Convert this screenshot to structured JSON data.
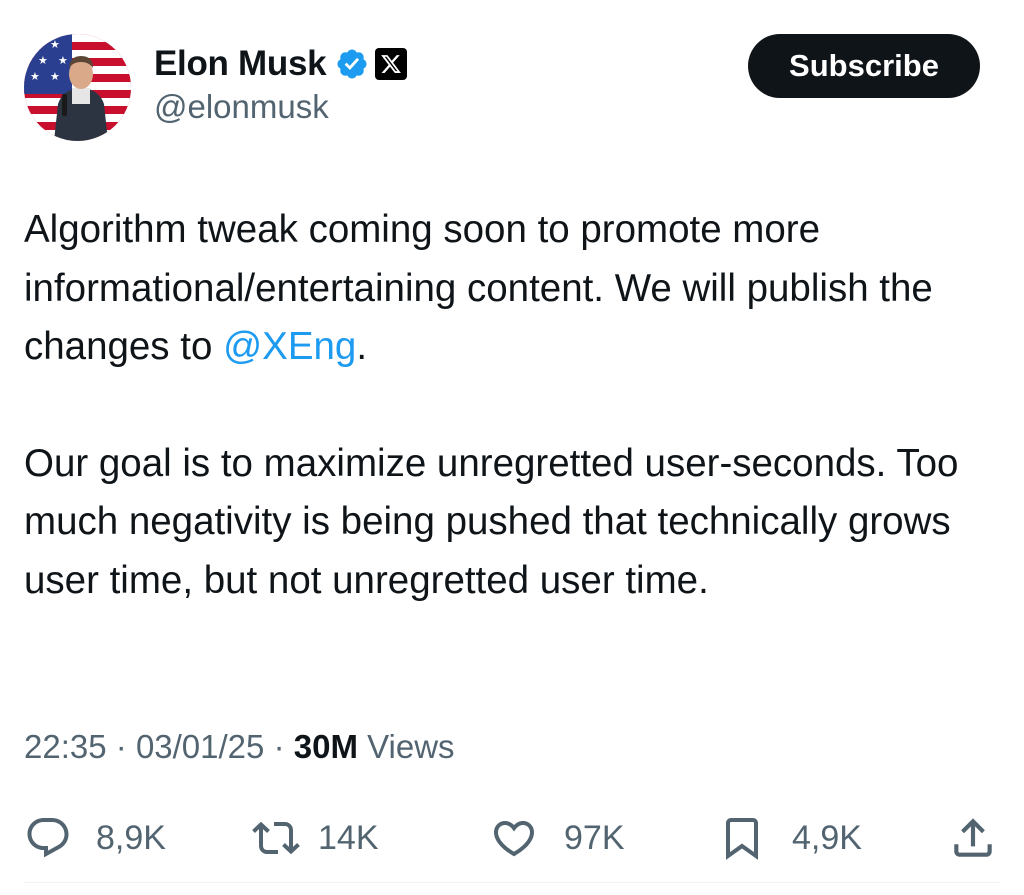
{
  "author": {
    "name": "Elon Musk",
    "handle": "@elonmusk",
    "verified_color": "#1d9bf0"
  },
  "header": {
    "subscribe_label": "Subscribe"
  },
  "tweet": {
    "p1_before": "Algorithm tweak coming soon to promote more informational/entertaining content. We will publish the changes to ",
    "mention": "@XEng",
    "p1_after": ".",
    "p2": "Our goal is to maximize unregretted user-seconds. Too much negativity is being pushed that technically grows user time, but not unregretted user time."
  },
  "meta": {
    "time": "22:35",
    "date": "03/01/25",
    "views_count": "30M",
    "views_label": "Views",
    "separator": "·"
  },
  "actions": {
    "replies": "8,9K",
    "reposts": "14K",
    "likes": "97K",
    "bookmarks": "4,9K"
  },
  "colors": {
    "text": "#0f1419",
    "secondary": "#536471",
    "link": "#1d9bf0",
    "button_bg": "#0f1419"
  },
  "icons": [
    "verified-badge-icon",
    "x-logo-icon",
    "reply-icon",
    "repost-icon",
    "like-icon",
    "bookmark-icon",
    "share-icon"
  ]
}
